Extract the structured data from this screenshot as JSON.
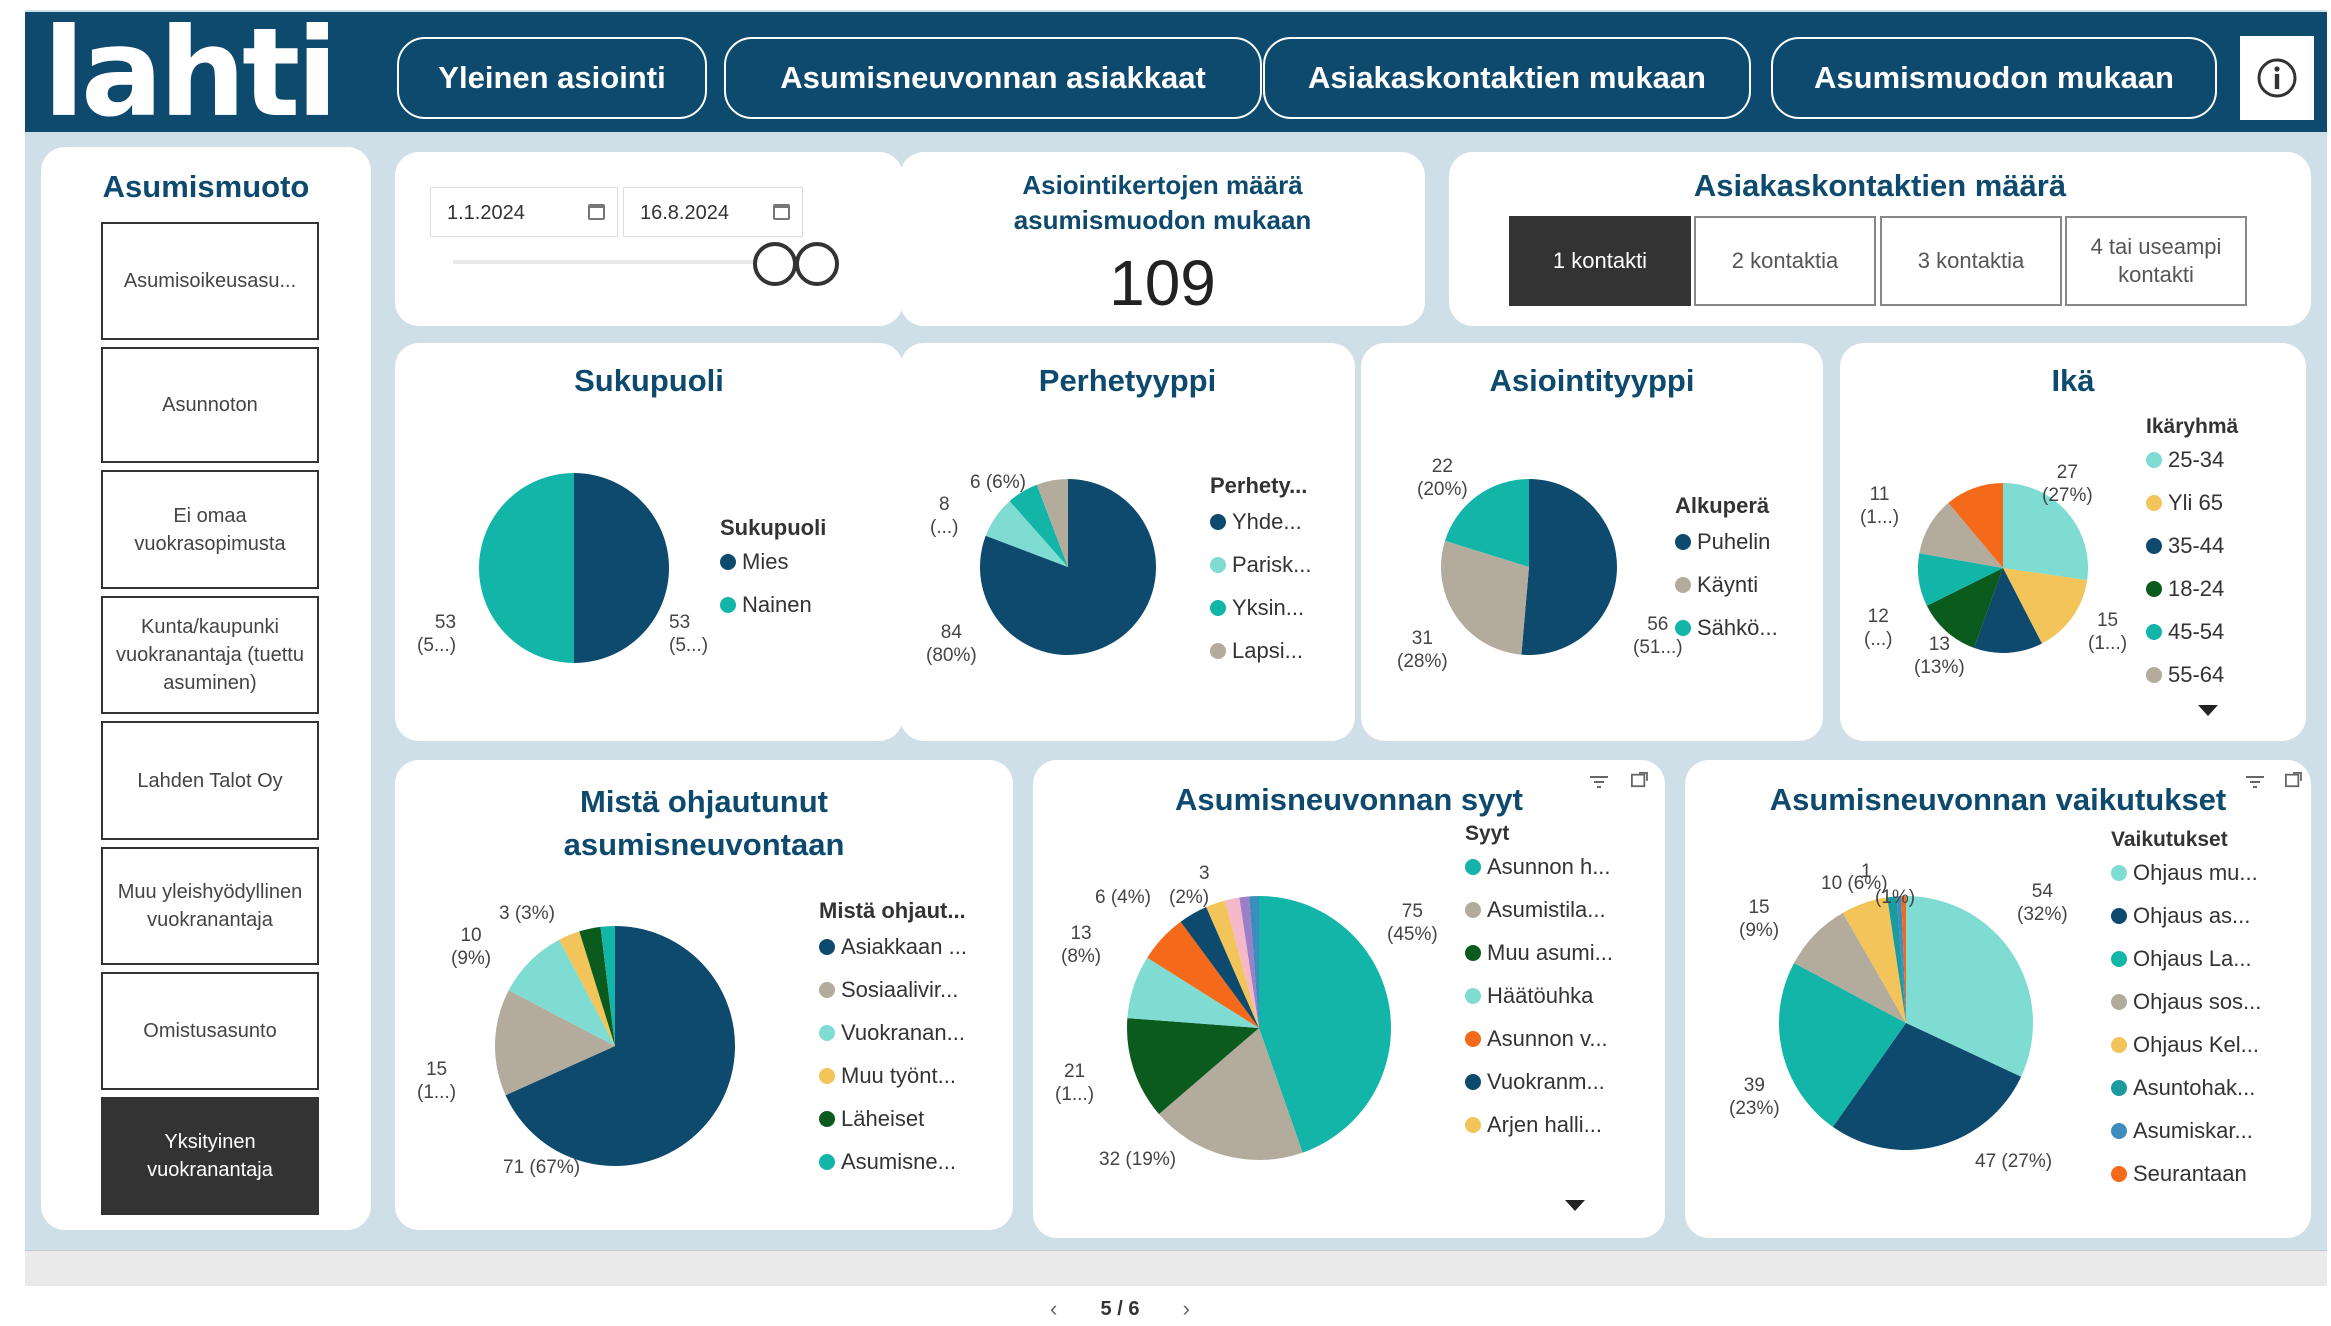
{
  "header": {
    "logo": "lahti",
    "nav": [
      "Yleinen asiointi",
      "Asumisneuvonnan asiakkaat",
      "Asiakaskontaktien mukaan",
      "Asumismuodon mukaan"
    ],
    "info_icon": "info-icon"
  },
  "slicer": {
    "title": "Asumismuoto",
    "items": [
      "Asumisoikeusasu...",
      "Asunnoton",
      "Ei omaa vuokrasopimusta",
      "Kunta/kaupunki vuokranantaja (tuettu asuminen)",
      "Lahden Talot Oy",
      "Muu yleishyödyllinen vuokranantaja",
      "Omistusasunto",
      "Yksityinen vuokranantaja"
    ],
    "selected": "Yksityinen vuokranantaja"
  },
  "date_filter": {
    "start": "1.1.2024",
    "end": "16.8.2024"
  },
  "kpi": {
    "title": "Asiointikertojen määrä asumismuodon mukaan",
    "value": "109"
  },
  "contacts": {
    "title": "Asiakaskontaktien määrä",
    "buttons": [
      "1 kontakti",
      "2 kontaktia",
      "3 kontaktia",
      "4 tai useampi kontakti"
    ],
    "selected": "1 kontakti"
  },
  "colors": {
    "navy": "#0e4a6e",
    "teal": "#12b5a8",
    "gray": "#b3ac9c",
    "mint": "#7fdcd3",
    "yellow": "#f2c45a",
    "green": "#0b5a1e",
    "orange": "#f56a1a",
    "pink": "#f4b8c8",
    "purple": "#9b7fc8",
    "blue": "#3c8dbc",
    "mustard": "#e6b84a",
    "darkteal": "#1b9aa0"
  },
  "chart_data": [
    {
      "type": "pie",
      "title": "Sukupuoli",
      "legend_title": "Sukupuoli",
      "slices": [
        {
          "name": "Mies",
          "value": 53,
          "label": "53\n(5...)",
          "color": "#0e4a6e"
        },
        {
          "name": "Nainen",
          "value": 53,
          "label": "53\n(5...)",
          "color": "#12b5a8"
        }
      ]
    },
    {
      "type": "pie",
      "title": "Perhetyyppi",
      "legend_title": "Perhety...",
      "slices": [
        {
          "name": "Yhde...",
          "value": 84,
          "label": "84\n(80%)",
          "color": "#0e4a6e"
        },
        {
          "name": "Parisk...",
          "value": 8,
          "label": "8\n(...)",
          "color": "#7fdcd3"
        },
        {
          "name": "Yksin...",
          "value": 6,
          "label": "6 (6%)",
          "color": "#12b5a8"
        },
        {
          "name": "Lapsi...",
          "value": 6,
          "label": "",
          "color": "#b3ac9c"
        }
      ]
    },
    {
      "type": "pie",
      "title": "Asiointityyppi",
      "legend_title": "Alkuperä",
      "slices": [
        {
          "name": "Puhelin",
          "value": 56,
          "label": "56\n(51...)",
          "color": "#0e4a6e"
        },
        {
          "name": "Käynti",
          "value": 31,
          "label": "31\n(28%)",
          "color": "#b3ac9c"
        },
        {
          "name": "Sähkö...",
          "value": 22,
          "label": "22\n(20%)",
          "color": "#12b5a8"
        }
      ]
    },
    {
      "type": "pie",
      "title": "Ikä",
      "legend_title": "Ikäryhmä",
      "slices": [
        {
          "name": "25-34",
          "value": 27,
          "label": "27\n(27%)",
          "color": "#7fdcd3"
        },
        {
          "name": "Yli 65",
          "value": 15,
          "label": "15\n(1...)",
          "color": "#f2c45a"
        },
        {
          "name": "35-44",
          "value": 13,
          "label": "13\n(13%)",
          "color": "#0e4a6e"
        },
        {
          "name": "18-24",
          "value": 12,
          "label": "12\n(...)",
          "color": "#0b5a1e"
        },
        {
          "name": "45-54",
          "value": 10,
          "label": "",
          "color": "#12b5a8"
        },
        {
          "name": "55-64",
          "value": 11,
          "label": "",
          "color": "#b3ac9c"
        },
        {
          "name": "",
          "value": 11,
          "label": "11\n(1...)",
          "color": "#f56a1a"
        }
      ]
    },
    {
      "type": "pie",
      "title": "Mistä ohjautunut asumisneuvontaan",
      "legend_title": "Mistä ohjaut...",
      "slices": [
        {
          "name": "Asiakkaan ...",
          "value": 71,
          "label": "71 (67%)",
          "color": "#0e4a6e"
        },
        {
          "name": "Sosiaalivir...",
          "value": 15,
          "label": "15\n(1...)",
          "color": "#b3ac9c"
        },
        {
          "name": "Vuokranan...",
          "value": 10,
          "label": "10\n(9%)",
          "color": "#7fdcd3"
        },
        {
          "name": "Muu työnt...",
          "value": 3,
          "label": "3 (3%)",
          "color": "#f2c45a"
        },
        {
          "name": "Läheiset",
          "value": 3,
          "label": "",
          "color": "#0b5a1e"
        },
        {
          "name": "Asumisne...",
          "value": 2,
          "label": "",
          "color": "#12b5a8"
        }
      ]
    },
    {
      "type": "pie",
      "title": "Asumisneuvonnan syyt",
      "legend_title": "Syyt",
      "slices": [
        {
          "name": "Asunnon h...",
          "value": 75,
          "label": "75\n(45%)",
          "color": "#12b5a8"
        },
        {
          "name": "Asumistila...",
          "value": 32,
          "label": "32 (19%)",
          "color": "#b3ac9c"
        },
        {
          "name": "Muu asumi...",
          "value": 21,
          "label": "21\n(1...)",
          "color": "#0b5a1e"
        },
        {
          "name": "Häätöuhka",
          "value": 13,
          "label": "13\n(8%)",
          "color": "#7fdcd3"
        },
        {
          "name": "Asunnon v...",
          "value": 10,
          "label": "",
          "color": "#f56a1a"
        },
        {
          "name": "Vuokranm...",
          "value": 6,
          "label": "6 (4%)",
          "color": "#0e4a6e"
        },
        {
          "name": "Arjen halli...",
          "value": 4,
          "label": "(2%)",
          "color": "#f2c45a"
        },
        {
          "name": "",
          "value": 3,
          "label": "3",
          "color": "#f4b8c8"
        },
        {
          "name": "",
          "value": 2,
          "label": "",
          "color": "#9b7fc8"
        },
        {
          "name": "",
          "value": 2,
          "label": "",
          "color": "#3c8dbc"
        }
      ]
    },
    {
      "type": "pie",
      "title": "Asumisneuvonnan vaikutukset",
      "legend_title": "Vaikutukset",
      "slices": [
        {
          "name": "Ohjaus mu...",
          "value": 54,
          "label": "54\n(32%)",
          "color": "#7fdcd3"
        },
        {
          "name": "Ohjaus as...",
          "value": 47,
          "label": "47 (27%)",
          "color": "#0e4a6e"
        },
        {
          "name": "Ohjaus La...",
          "value": 39,
          "label": "39\n(23%)",
          "color": "#12b5a8"
        },
        {
          "name": "Ohjaus sos...",
          "value": 15,
          "label": "15\n(9%)",
          "color": "#b3ac9c"
        },
        {
          "name": "Ohjaus Kel...",
          "value": 10,
          "label": "10 (6%)",
          "color": "#f2c45a"
        },
        {
          "name": "Asuntohak...",
          "value": 2,
          "label": "(1%)",
          "color": "#1b9aa0"
        },
        {
          "name": "Asumiskar...",
          "value": 1,
          "label": "1",
          "color": "#3c8dbc"
        },
        {
          "name": "Seurantaan",
          "value": 1,
          "label": "",
          "color": "#f56a1a"
        }
      ]
    }
  ],
  "footer": {
    "page": "5 / 6"
  }
}
